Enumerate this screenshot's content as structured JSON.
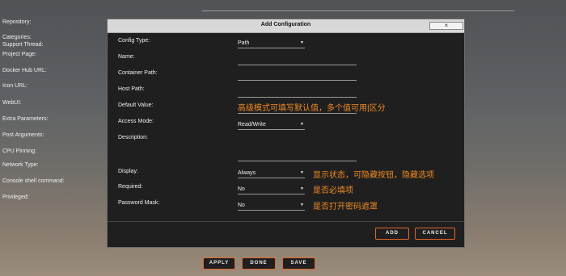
{
  "background_form": {
    "labels": [
      "Repository:",
      "Categories:",
      "Support Thread:",
      "Project Page:",
      "Docker Hub URL:",
      "Icon URL:",
      "WebUI:",
      "Extra Parameters:",
      "Post Arguments:",
      "CPU Pinning:",
      "Network Type:",
      "Console shell command:",
      "Privileged:"
    ]
  },
  "dialog": {
    "title": "Add Configuration",
    "close_glyph": "×",
    "fields": {
      "config_type": {
        "label": "Config Type:",
        "value": "Path"
      },
      "name": {
        "label": "Name:",
        "value": ""
      },
      "container_path": {
        "label": "Container Path:",
        "value": ""
      },
      "host_path": {
        "label": "Host Path:",
        "value": ""
      },
      "default_value": {
        "label": "Default Value:",
        "value": ""
      },
      "access_mode": {
        "label": "Access Mode:",
        "value": "Read/Write"
      },
      "description": {
        "label": "Description:",
        "value": ""
      },
      "display": {
        "label": "Display:",
        "value": "Always"
      },
      "required": {
        "label": "Required:",
        "value": "No"
      },
      "password_mask": {
        "label": "Password Mask:",
        "value": "No"
      }
    },
    "notes": {
      "default_value": "高级模式可填写默认值，多个值可用|区分",
      "display": "显示状态，可隐藏按钮，隐藏选项",
      "required": "是否必填项",
      "password_mask": "是否打开密码遮罩"
    },
    "buttons": {
      "add": "ADD",
      "cancel": "CANCEL"
    }
  },
  "page_buttons": {
    "apply": "APPLY",
    "done": "DONE",
    "save": "SAVE"
  },
  "colors": {
    "accent": "#e0662c",
    "note": "#f08a24",
    "dialog_bg": "#1f1f1f",
    "titlebar_bg": "#d8d8d8"
  },
  "icons": {
    "dropdown": "triangle-down"
  }
}
